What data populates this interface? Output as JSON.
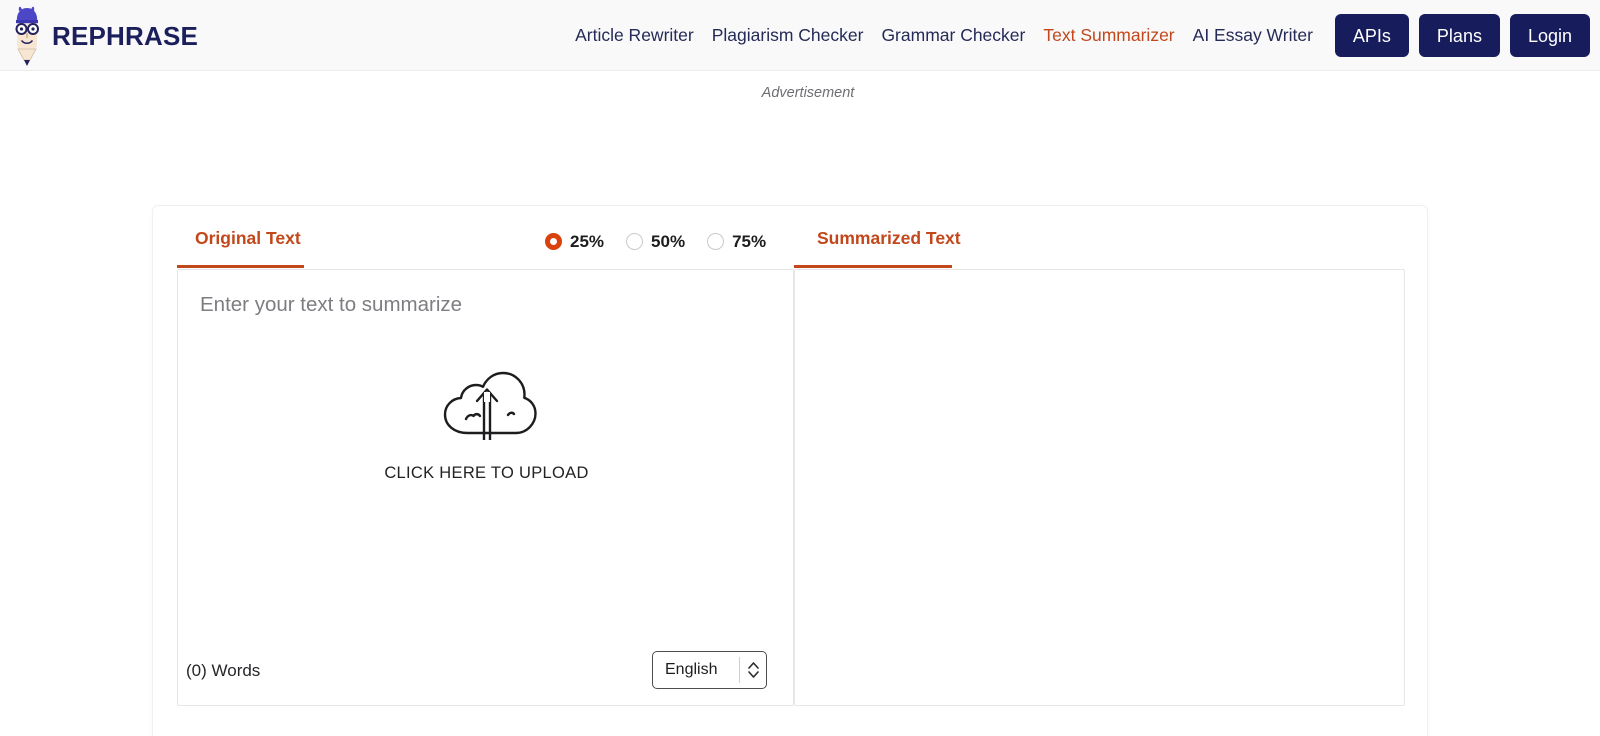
{
  "header": {
    "brand": {
      "name": "REPHRASE",
      "icon": "pencil-mascot-logo",
      "hair_color": "#4b47c7",
      "face_color": "#f5e3cf",
      "text_color": "#1b1f5c"
    },
    "nav_links": [
      {
        "label": "Article Rewriter",
        "active": false
      },
      {
        "label": "Plagiarism Checker",
        "active": false
      },
      {
        "label": "Grammar Checker",
        "active": false
      },
      {
        "label": "Text Summarizer",
        "active": true
      },
      {
        "label": "AI Essay Writer",
        "active": false
      }
    ],
    "buttons": [
      {
        "label": "APIs"
      },
      {
        "label": "Plans"
      },
      {
        "label": "Login"
      }
    ],
    "button_color": "#171c5c",
    "active_link_color": "#c2481b"
  },
  "advertisement": {
    "label": "Advertisement"
  },
  "tool": {
    "tabs": {
      "original": "Original Text",
      "summarized": "Summarized Text"
    },
    "accent_color": "#c2481b",
    "summary_ratio": {
      "options": [
        {
          "label": "25%",
          "value": "25",
          "selected": true
        },
        {
          "label": "50%",
          "value": "50",
          "selected": false
        },
        {
          "label": "75%",
          "value": "75",
          "selected": false
        }
      ],
      "selected_value": "25",
      "selected_color": "#d9420d"
    },
    "editor": {
      "placeholder": "Enter your text to summarize",
      "value": "",
      "upload_icon": "cloud-upload-icon",
      "upload_text": "CLICK HERE TO UPLOAD",
      "word_count": "(0) Words",
      "language": {
        "selected": "English",
        "options": [
          "English"
        ]
      }
    },
    "output": {
      "value": ""
    }
  }
}
